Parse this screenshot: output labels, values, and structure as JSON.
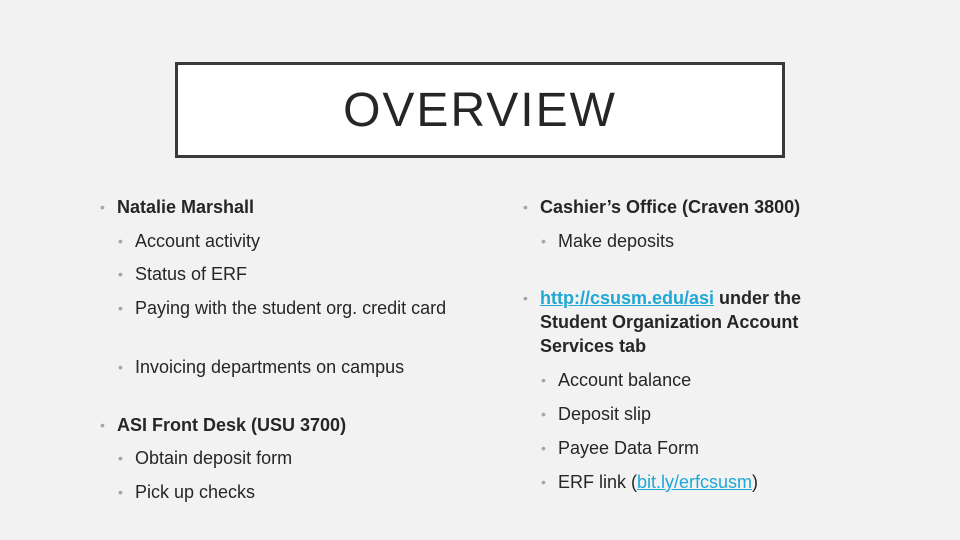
{
  "title": "OVERVIEW",
  "colors": {
    "background": "#f2f2f2",
    "title_box": "#ffffff",
    "title_border": "#3a3a3a",
    "text": "#262626",
    "bullet": "#a5a5a5",
    "link": "#1fa8d6"
  },
  "left": {
    "section1": {
      "heading": "Natalie Marshall",
      "items": [
        "Account activity",
        "Status of ERF",
        "Paying with the student org. credit card",
        "Invoicing departments on campus"
      ]
    },
    "section2": {
      "heading": "ASI Front Desk (USU 3700)",
      "items": [
        "Obtain deposit form",
        "Pick up checks"
      ]
    }
  },
  "right": {
    "section1": {
      "heading": "Cashier’s Office (Craven 3800)",
      "items": [
        "Make deposits"
      ]
    },
    "section2": {
      "link": "http://csusm.edu/asi",
      "heading_rest": " under the Student Organization Account Services tab",
      "items": [
        "Account balance",
        "Deposit slip",
        "Payee Data Form"
      ],
      "erf_prefix": "ERF link (",
      "erf_link": "bit.ly/erfcsusm",
      "erf_suffix": ")"
    }
  }
}
